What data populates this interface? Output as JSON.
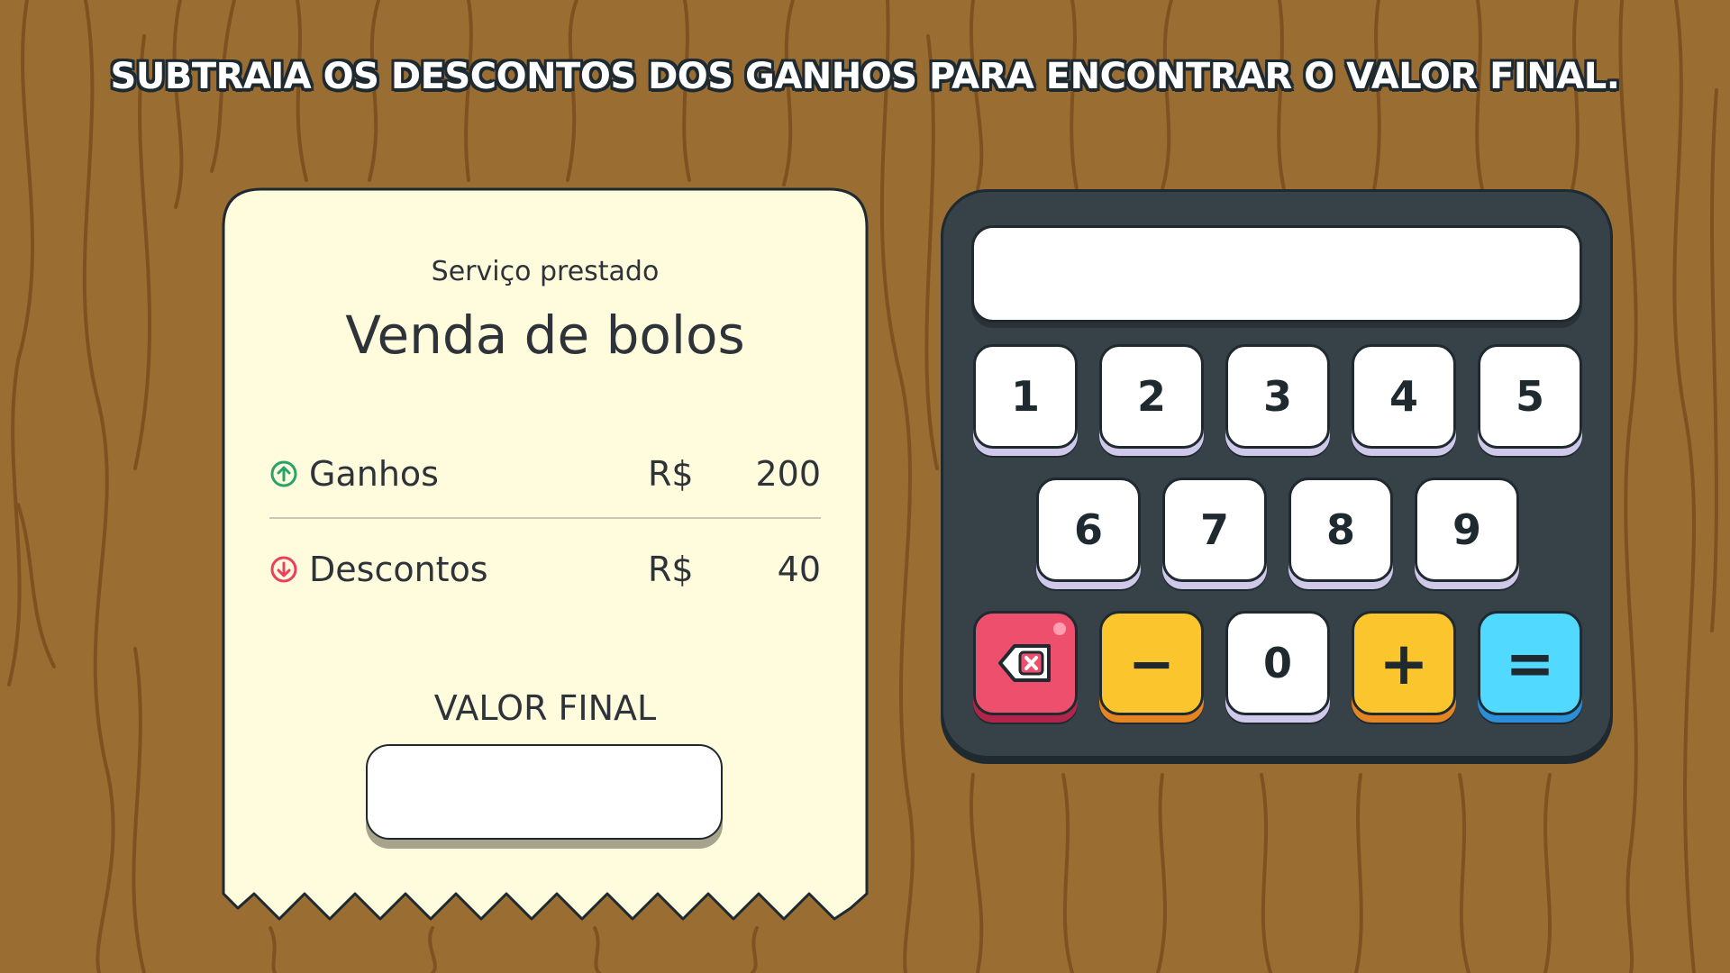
{
  "instruction": "SUBTRAIA OS DESCONTOS DOS GANHOS PARA ENCONTRAR O VALOR FINAL.",
  "receipt": {
    "subtitle": "Serviço prestado",
    "title": "Venda de bolos",
    "gains": {
      "label": "Ganhos",
      "currency": "R$",
      "value": "200",
      "icon": "arrow-up-circle-icon",
      "color": "#2aa36b"
    },
    "discounts": {
      "label": "Descontos",
      "currency": "R$",
      "value": "40",
      "icon": "arrow-down-circle-icon",
      "color": "#e8405f"
    },
    "final_label": "VALOR FINAL",
    "final_value": ""
  },
  "calculator": {
    "display": "",
    "keys_row1": [
      "1",
      "2",
      "3",
      "4",
      "5"
    ],
    "keys_row2": [
      "6",
      "7",
      "8",
      "9"
    ],
    "key_minus": "−",
    "key_zero": "0",
    "key_plus": "+",
    "key_equals": "=",
    "key_backspace_icon": "backspace-icon"
  },
  "colors": {
    "background": "#9a6d33",
    "receipt": "#fffbdd",
    "calculator": "#374148",
    "key_red": "#ee4f6d",
    "key_yellow": "#fbc52e",
    "key_blue": "#52d9ff"
  }
}
